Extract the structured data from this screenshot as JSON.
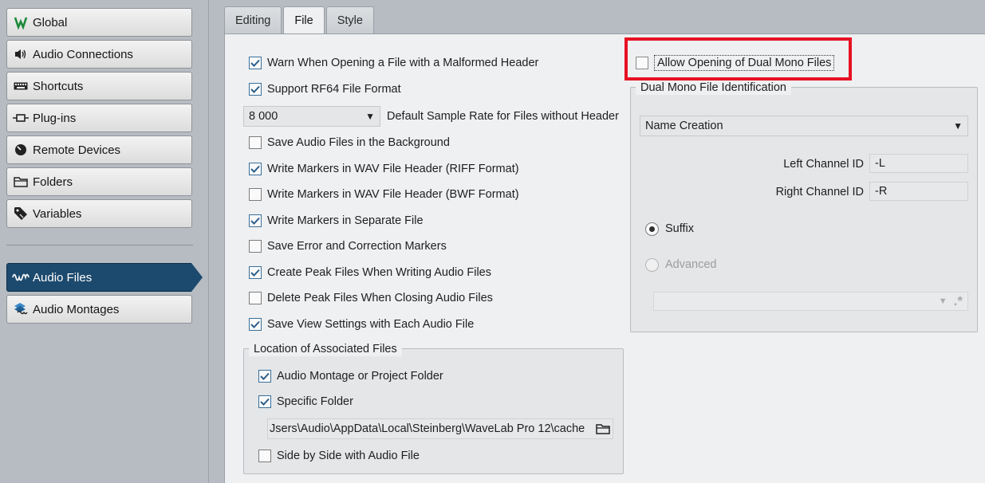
{
  "sidebar": {
    "items": [
      {
        "label": "Global",
        "icon": "wavelab-logo-icon"
      },
      {
        "label": "Audio Connections",
        "icon": "speaker-icon"
      },
      {
        "label": "Shortcuts",
        "icon": "keyboard-icon"
      },
      {
        "label": "Plug-ins",
        "icon": "plugin-icon"
      },
      {
        "label": "Remote Devices",
        "icon": "knob-icon"
      },
      {
        "label": "Folders",
        "icon": "folder-icon"
      },
      {
        "label": "Variables",
        "icon": "tag-icon"
      }
    ],
    "doc_items": [
      {
        "label": "Audio Files",
        "icon": "waveform-icon",
        "active": true
      },
      {
        "label": "Audio Montages",
        "icon": "montage-icon"
      }
    ]
  },
  "tabs": [
    {
      "label": "Editing"
    },
    {
      "label": "File",
      "active": true
    },
    {
      "label": "Style"
    }
  ],
  "options": {
    "warn_malformed": {
      "label": "Warn When Opening a File with a Malformed Header",
      "checked": true
    },
    "support_rf64": {
      "label": "Support RF64 File Format",
      "checked": true
    },
    "sample_rate": {
      "value": "8 000",
      "label": "Default Sample Rate for Files without Header"
    },
    "save_background": {
      "label": "Save Audio Files in the Background",
      "checked": false
    },
    "markers_riff": {
      "label": "Write Markers in WAV File Header (RIFF Format)",
      "checked": true
    },
    "markers_bwf": {
      "label": "Write Markers in WAV File Header (BWF Format)",
      "checked": false
    },
    "markers_separate": {
      "label": "Write Markers in Separate File",
      "checked": true
    },
    "error_markers": {
      "label": "Save Error and Correction Markers",
      "checked": false
    },
    "create_peak": {
      "label": "Create Peak Files When Writing Audio Files",
      "checked": true
    },
    "delete_peak": {
      "label": "Delete Peak Files When Closing Audio Files",
      "checked": false
    },
    "save_view": {
      "label": "Save View Settings with Each Audio File",
      "checked": true
    }
  },
  "location": {
    "legend": "Location of Associated Files",
    "montage_folder": {
      "label": "Audio Montage or Project Folder",
      "checked": true
    },
    "specific_folder": {
      "label": "Specific Folder",
      "checked": true
    },
    "path": "Jsers\\Audio\\AppData\\Local\\Steinberg\\WaveLab Pro 12\\cache",
    "side_by_side": {
      "label": "Side by Side with Audio File",
      "checked": false
    }
  },
  "dual_mono": {
    "allow": {
      "label": "Allow Opening of Dual Mono Files",
      "checked": false
    },
    "legend": "Dual Mono File Identification",
    "mode": "Name Creation",
    "left_label": "Left Channel ID",
    "left_value": "-L",
    "right_label": "Right Channel ID",
    "right_value": "-R",
    "suffix_label": "Suffix",
    "advanced_label": "Advanced",
    "regex_glyph": ".*"
  },
  "colors": {
    "active_item": "#1c4a6e",
    "highlight": "#e81123",
    "check": "#2b5f8c"
  }
}
